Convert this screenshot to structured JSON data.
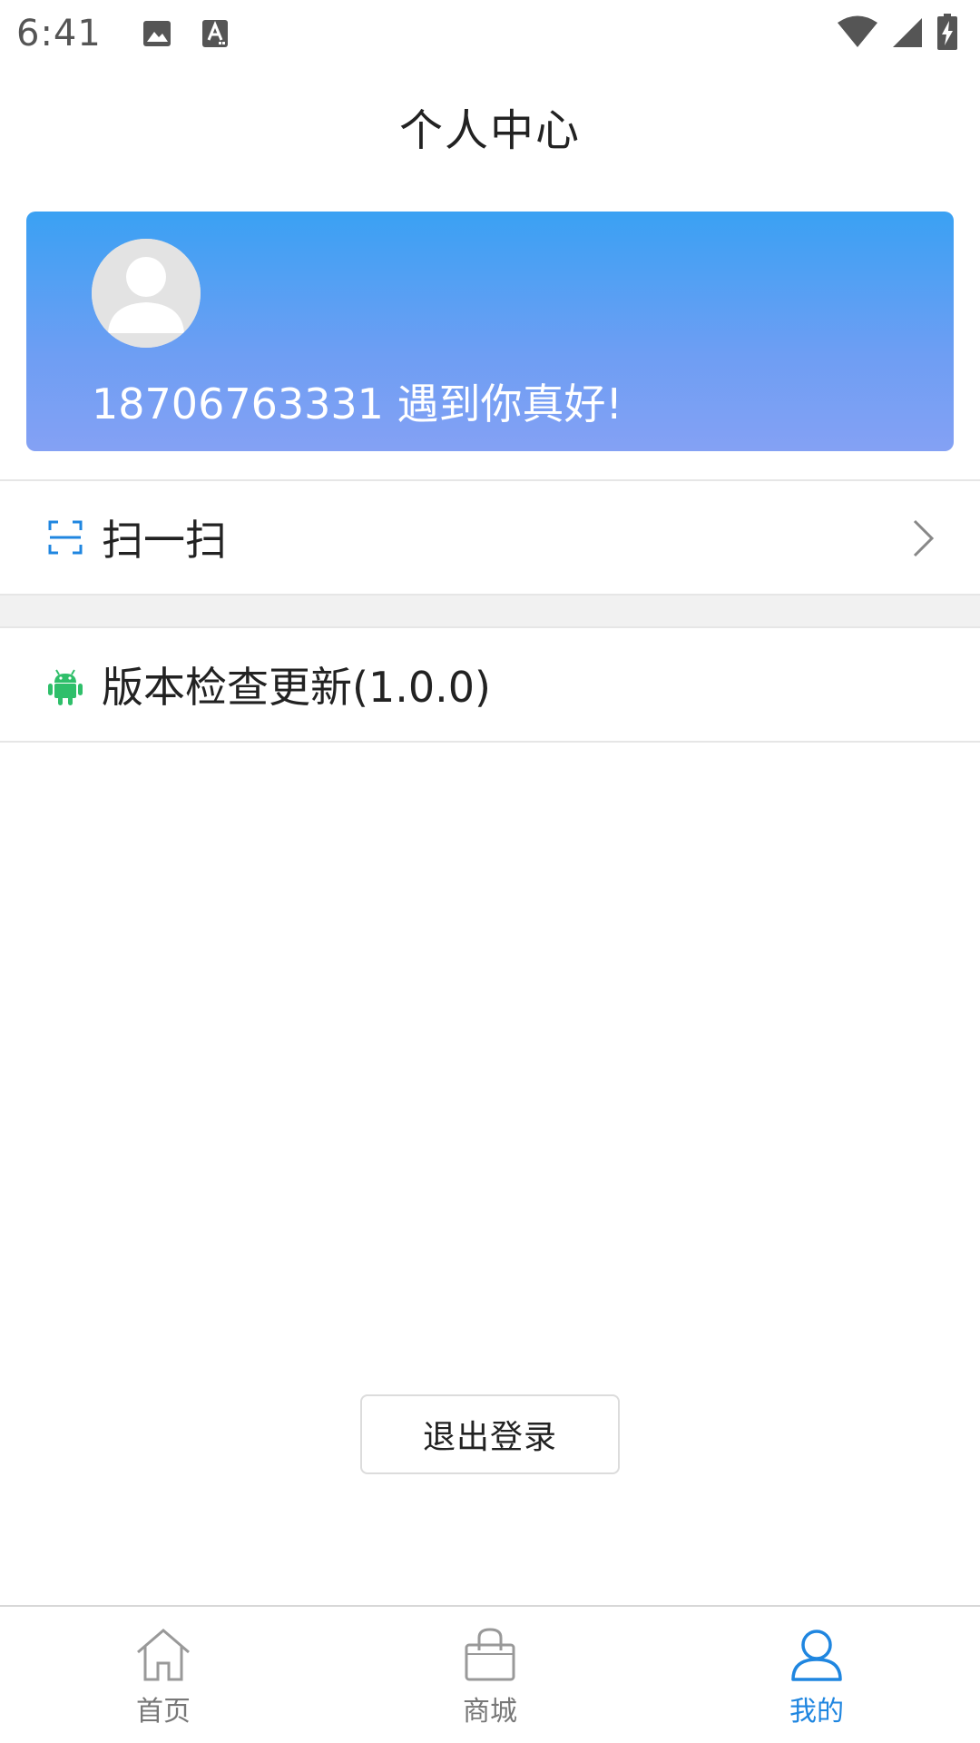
{
  "status_bar": {
    "time": "6:41",
    "left_icons": [
      "image-icon",
      "text-a-icon"
    ],
    "right_icons": [
      "wifi-icon",
      "cell-signal-icon",
      "battery-charging-icon"
    ]
  },
  "header": {
    "title": "个人中心"
  },
  "profile": {
    "greeting": "18706763331 遇到你真好!",
    "avatar_icon": "avatar-placeholder-icon",
    "gradient_top": "#3aa1f3",
    "gradient_bottom": "#84a1f4"
  },
  "menu": {
    "scan": {
      "label": "扫一扫",
      "icon": "scan-frame-icon",
      "accent": "#1f86e0"
    },
    "version": {
      "label": "版本检查更新(1.0.0)",
      "icon": "android-icon",
      "accent": "#2fbf6a"
    }
  },
  "logout": {
    "label": "退出登录"
  },
  "bottom_nav": {
    "items": [
      {
        "label": "首页",
        "icon": "home-icon"
      },
      {
        "label": "商城",
        "icon": "shopping-bag-icon"
      },
      {
        "label": "我的",
        "icon": "user-icon",
        "active": true
      }
    ],
    "active_color": "#1f86e0",
    "inactive_color": "#777777"
  }
}
